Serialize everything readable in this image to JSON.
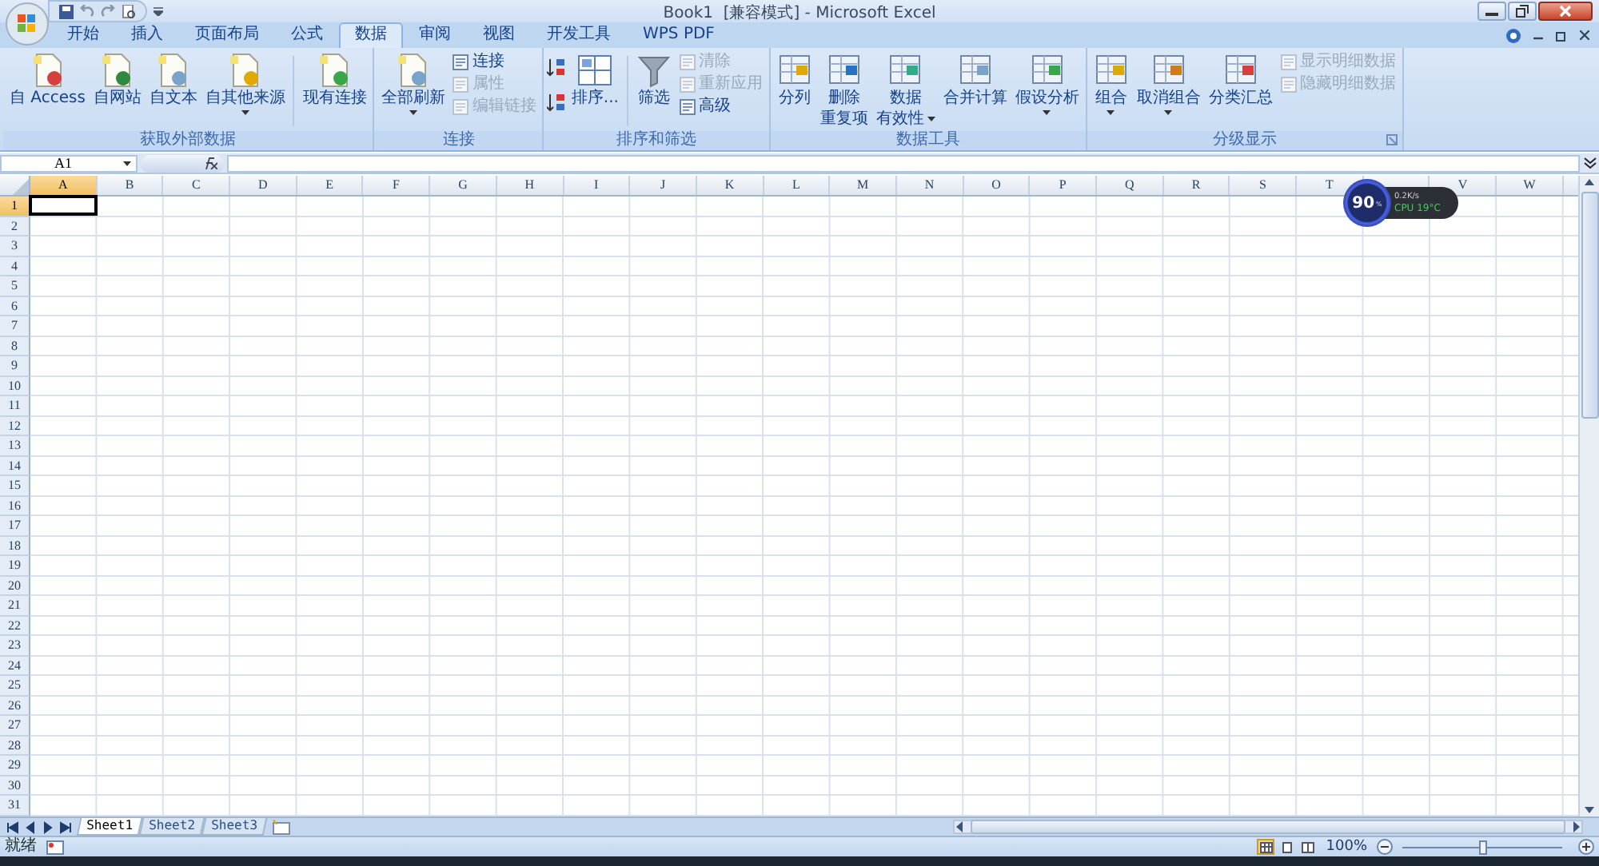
{
  "window": {
    "title": "Book1  [兼容模式] - Microsoft Excel"
  },
  "tabs": [
    {
      "label": "开始",
      "selected": false
    },
    {
      "label": "插入",
      "selected": false
    },
    {
      "label": "页面布局",
      "selected": false
    },
    {
      "label": "公式",
      "selected": false
    },
    {
      "label": "数据",
      "selected": true
    },
    {
      "label": "审阅",
      "selected": false
    },
    {
      "label": "视图",
      "selected": false
    },
    {
      "label": "开发工具",
      "selected": false
    },
    {
      "label": "WPS PDF",
      "selected": false
    }
  ],
  "ribbon": {
    "groups": [
      {
        "label": "获取外部数据",
        "launcher": false,
        "commands": [
          {
            "kind": "large",
            "label": "自 Access",
            "dropdown": false,
            "disabled": false
          },
          {
            "kind": "large",
            "label": "自网站",
            "dropdown": false,
            "disabled": false
          },
          {
            "kind": "large",
            "label": "自文本",
            "dropdown": false,
            "disabled": false
          },
          {
            "kind": "large",
            "label": "自其他来源",
            "dropdown": true,
            "disabled": false
          },
          {
            "kind": "separator"
          },
          {
            "kind": "large",
            "label": "现有连接",
            "dropdown": false,
            "disabled": false
          }
        ]
      },
      {
        "label": "连接",
        "launcher": false,
        "commands": [
          {
            "kind": "large",
            "label": "全部刷新",
            "dropdown": true,
            "disabled": false
          },
          {
            "kind": "small_stack",
            "items": [
              {
                "label": "连接",
                "disabled": false
              },
              {
                "label": "属性",
                "disabled": true
              },
              {
                "label": "编辑链接",
                "disabled": true
              }
            ]
          }
        ]
      },
      {
        "label": "排序和筛选",
        "launcher": false,
        "commands": [
          {
            "kind": "sort_pair"
          },
          {
            "kind": "large",
            "label": "排序...",
            "dropdown": false,
            "disabled": false
          },
          {
            "kind": "separator"
          },
          {
            "kind": "large",
            "label": "筛选",
            "dropdown": false,
            "disabled": false
          },
          {
            "kind": "small_stack",
            "items": [
              {
                "label": "清除",
                "disabled": true
              },
              {
                "label": "重新应用",
                "disabled": true
              },
              {
                "label": "高级",
                "disabled": false
              }
            ]
          }
        ]
      },
      {
        "label": "数据工具",
        "launcher": false,
        "commands": [
          {
            "kind": "large",
            "label": "分列",
            "dropdown": false,
            "disabled": false
          },
          {
            "kind": "large",
            "lines": [
              "删除",
              "重复项"
            ],
            "dropdown": false,
            "disabled": false
          },
          {
            "kind": "large",
            "lines": [
              "数据",
              "有效性"
            ],
            "dropdown": true,
            "disabled": false
          },
          {
            "kind": "large",
            "label": "合并计算",
            "dropdown": false,
            "disabled": false
          },
          {
            "kind": "large",
            "label": "假设分析",
            "dropdown": true,
            "disabled": false
          }
        ]
      },
      {
        "label": "分级显示",
        "launcher": true,
        "commands": [
          {
            "kind": "large",
            "label": "组合",
            "dropdown": true,
            "disabled": false
          },
          {
            "kind": "large",
            "label": "取消组合",
            "dropdown": true,
            "disabled": false
          },
          {
            "kind": "large",
            "label": "分类汇总",
            "dropdown": false,
            "disabled": false
          },
          {
            "kind": "small_stack",
            "items": [
              {
                "label": "显示明细数据",
                "disabled": true
              },
              {
                "label": "隐藏明细数据",
                "disabled": true
              }
            ]
          }
        ]
      }
    ]
  },
  "formula_bar": {
    "name_box": "A1"
  },
  "sheet": {
    "columns": [
      {
        "label": "A",
        "selected": true
      },
      {
        "label": "B",
        "selected": false
      },
      {
        "label": "C",
        "selected": false
      },
      {
        "label": "D",
        "selected": false
      },
      {
        "label": "E",
        "selected": false
      },
      {
        "label": "F",
        "selected": false
      },
      {
        "label": "G",
        "selected": false
      },
      {
        "label": "H",
        "selected": false
      },
      {
        "label": "I",
        "selected": false
      },
      {
        "label": "J",
        "selected": false
      },
      {
        "label": "K",
        "selected": false
      },
      {
        "label": "L",
        "selected": false
      },
      {
        "label": "M",
        "selected": false
      },
      {
        "label": "N",
        "selected": false
      },
      {
        "label": "O",
        "selected": false
      },
      {
        "label": "P",
        "selected": false
      },
      {
        "label": "Q",
        "selected": false
      },
      {
        "label": "R",
        "selected": false
      },
      {
        "label": "S",
        "selected": false
      },
      {
        "label": "T",
        "selected": false
      },
      {
        "selected": false
      },
      {
        "label": "V",
        "selected": false
      },
      {
        "label": "W",
        "selected": false
      }
    ],
    "rows": [
      {
        "label": "1",
        "selected": true
      },
      {
        "label": "2",
        "selected": false
      },
      {
        "label": "3",
        "selected": false
      },
      {
        "label": "4",
        "selected": false
      },
      {
        "label": "5",
        "selected": false
      },
      {
        "label": "6",
        "selected": false
      },
      {
        "label": "7",
        "selected": false
      },
      {
        "label": "8",
        "selected": false
      },
      {
        "label": "9",
        "selected": false
      },
      {
        "label": "10",
        "selected": false
      },
      {
        "label": "11",
        "selected": false
      },
      {
        "label": "12",
        "selected": false
      },
      {
        "label": "13",
        "selected": false
      },
      {
        "label": "14",
        "selected": false
      },
      {
        "label": "15",
        "selected": false
      },
      {
        "label": "16",
        "selected": false
      },
      {
        "label": "17",
        "selected": false
      },
      {
        "label": "18",
        "selected": false
      },
      {
        "label": "19",
        "selected": false
      },
      {
        "label": "20",
        "selected": false
      },
      {
        "label": "21",
        "selected": false
      },
      {
        "label": "22",
        "selected": false
      },
      {
        "label": "23",
        "selected": false
      },
      {
        "label": "24",
        "selected": false
      },
      {
        "label": "25",
        "selected": false
      },
      {
        "label": "26",
        "selected": false
      },
      {
        "label": "27",
        "selected": false
      },
      {
        "label": "28",
        "selected": false
      },
      {
        "label": "29",
        "selected": false
      },
      {
        "label": "30",
        "selected": false
      },
      {
        "label": "31",
        "selected": false
      }
    ]
  },
  "widget": {
    "value": "90",
    "unit": "%",
    "speed": "0.2K/s",
    "cpu": "CPU 19°C"
  },
  "sheet_tabs": [
    {
      "label": "Sheet1",
      "selected": true
    },
    {
      "label": "Sheet2",
      "selected": false
    },
    {
      "label": "Sheet3",
      "selected": false
    }
  ],
  "status_bar": {
    "status": "就绪",
    "views": [
      {
        "kind": "normal",
        "selected": true
      },
      {
        "kind": "page_layout",
        "selected": false
      },
      {
        "kind": "page_break",
        "selected": false
      }
    ],
    "zoom": "100%",
    "zoom_slider": {
      "level": 0.5
    }
  }
}
